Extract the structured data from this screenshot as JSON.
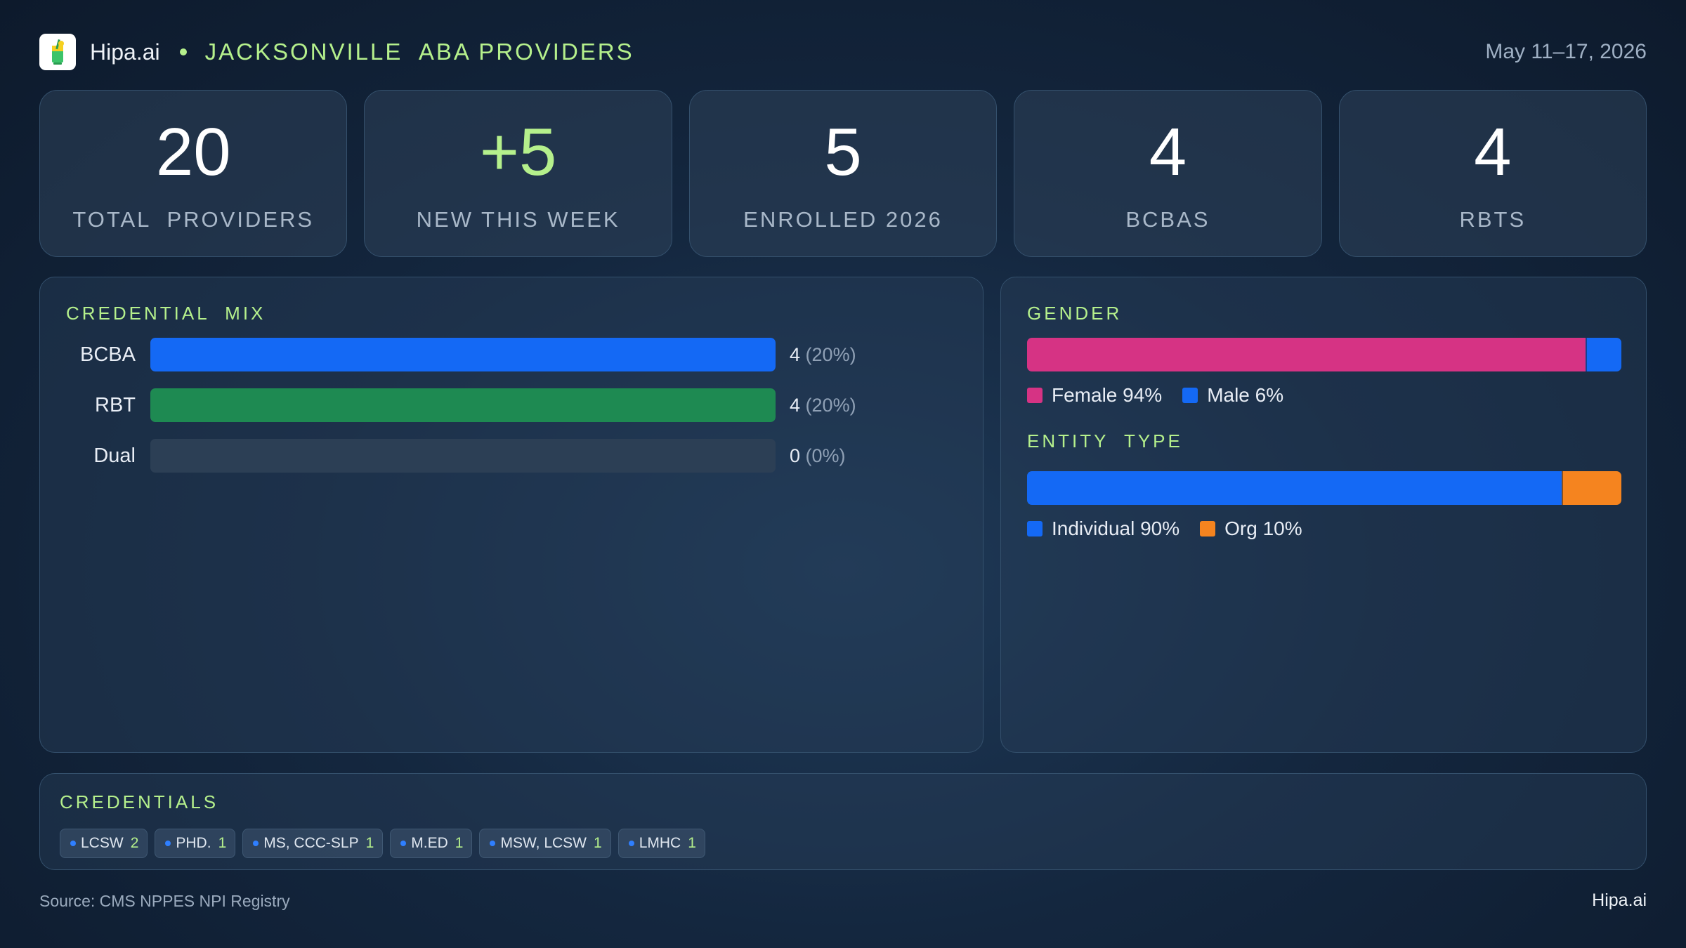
{
  "header": {
    "brand": "Hipa.ai",
    "region": "JACKSONVILLE  ABA PROVIDERS",
    "date_range": "May 11–17, 2026",
    "logo_icon": "cocktail-glass-icon"
  },
  "stats": [
    {
      "value": "20",
      "label": "TOTAL  PROVIDERS"
    },
    {
      "value": "+5",
      "label": "NEW THIS WEEK"
    },
    {
      "value": "5",
      "label": "ENROLLED 2026"
    },
    {
      "value": "4",
      "label": "BCBAS"
    },
    {
      "value": "4",
      "label": "RBTS"
    }
  ],
  "credential_mix": {
    "title": "CREDENTIAL  MIX",
    "rows": [
      {
        "label": "BCBA",
        "count": "4",
        "pct_text": "(20%)",
        "color": "#1469f5"
      },
      {
        "label": "RBT",
        "count": "4",
        "pct_text": "(20%)",
        "color": "#1e8a52"
      },
      {
        "label": "Dual",
        "count": "0",
        "pct_text": "(0%)",
        "color": "#2c3f55"
      }
    ]
  },
  "gender": {
    "title": "GENDER",
    "segments": [
      {
        "label": "Female 94%",
        "share": 0.94,
        "color": "#d63384"
      },
      {
        "label": "Male 6%",
        "share": 0.06,
        "color": "#1469f5"
      }
    ]
  },
  "entity_type": {
    "title": "ENTITY  TYPE",
    "segments": [
      {
        "label": "Individual 90%",
        "share": 0.9,
        "color": "#1469f5"
      },
      {
        "label": "Org 10%",
        "share": 0.1,
        "color": "#f5841f"
      }
    ]
  },
  "credentials": {
    "title": "CREDENTIALS",
    "chips": [
      {
        "name": "LCSW",
        "count": "2"
      },
      {
        "name": "PHD.",
        "count": "1"
      },
      {
        "name": "MS, CCC-SLP",
        "count": "1"
      },
      {
        "name": "M.ED",
        "count": "1"
      },
      {
        "name": "MSW, LCSW",
        "count": "1"
      },
      {
        "name": "LMHC",
        "count": "1"
      }
    ]
  },
  "footer": {
    "source": "Source: CMS NPPES NPI Registry",
    "brand": "Hipa.ai"
  },
  "chart_data": [
    {
      "type": "bar",
      "title": "CREDENTIAL  MIX",
      "categories": [
        "BCBA",
        "RBT",
        "Dual"
      ],
      "values": [
        4,
        4,
        0
      ],
      "percent": [
        20,
        20,
        0
      ]
    },
    {
      "type": "bar",
      "title": "GENDER",
      "categories": [
        "Female",
        "Male"
      ],
      "values": [
        94,
        6
      ]
    },
    {
      "type": "bar",
      "title": "ENTITY  TYPE",
      "categories": [
        "Individual",
        "Org"
      ],
      "values": [
        90,
        10
      ]
    }
  ]
}
